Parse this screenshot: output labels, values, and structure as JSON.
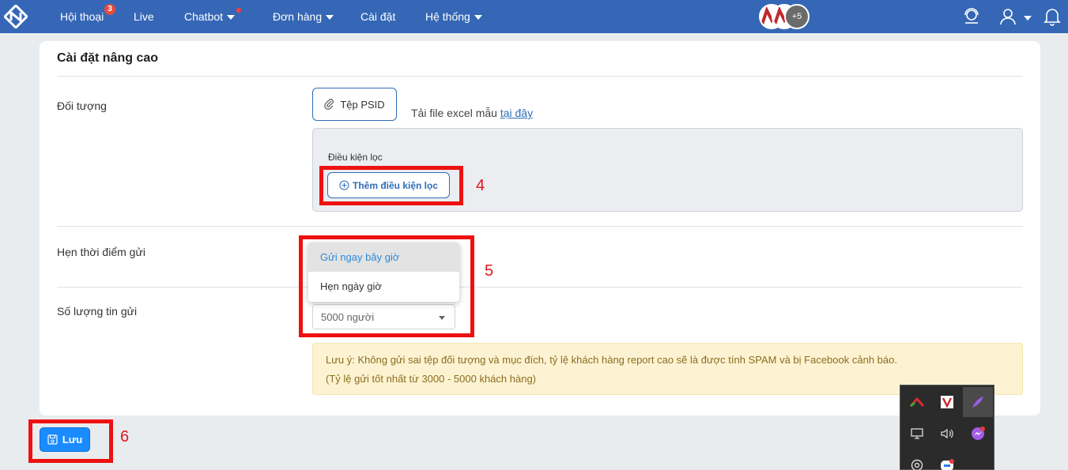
{
  "nav": {
    "items": [
      {
        "label": "Hội thoại",
        "badge": "3"
      },
      {
        "label": "Live"
      },
      {
        "label": "Chatbot"
      },
      {
        "label": "Đơn hàng"
      },
      {
        "label": "Cài đặt"
      },
      {
        "label": "Hệ thống"
      }
    ],
    "avatars_more": "+5"
  },
  "card": {
    "title": "Cài đặt nâng cao",
    "target": {
      "label": "Đối tượng",
      "psid_button": "Tệp PSID",
      "download_text": "Tải file excel mẫu",
      "download_link": "tại đây",
      "filter_label": "Điều kiện lọc",
      "add_filter_button": "Thêm điều kiện lọc"
    },
    "schedule": {
      "label": "Hẹn thời điểm gửi",
      "options": [
        "Gửi ngay bây giờ",
        "Hẹn ngày giờ"
      ]
    },
    "quantity": {
      "label": "Số lượng tin gửi",
      "value": "5000 người"
    },
    "note": {
      "line1": "Lưu ý: Không gửi sai tệp đối tượng và mục đích, tỷ lệ khách hàng report cao sẽ là được tính SPAM và bị Facebook cảnh báo.",
      "line2": "(Tỷ lệ gửi tốt nhất từ 3000 - 5000 khách hàng)"
    }
  },
  "save_button": "Lưu",
  "annotations": [
    "4",
    "5",
    "6"
  ],
  "colors": {
    "nav_bg": "#3567b6",
    "accent": "#2f6db5",
    "annotation": "#ee1111",
    "save": "#1a8cff"
  }
}
